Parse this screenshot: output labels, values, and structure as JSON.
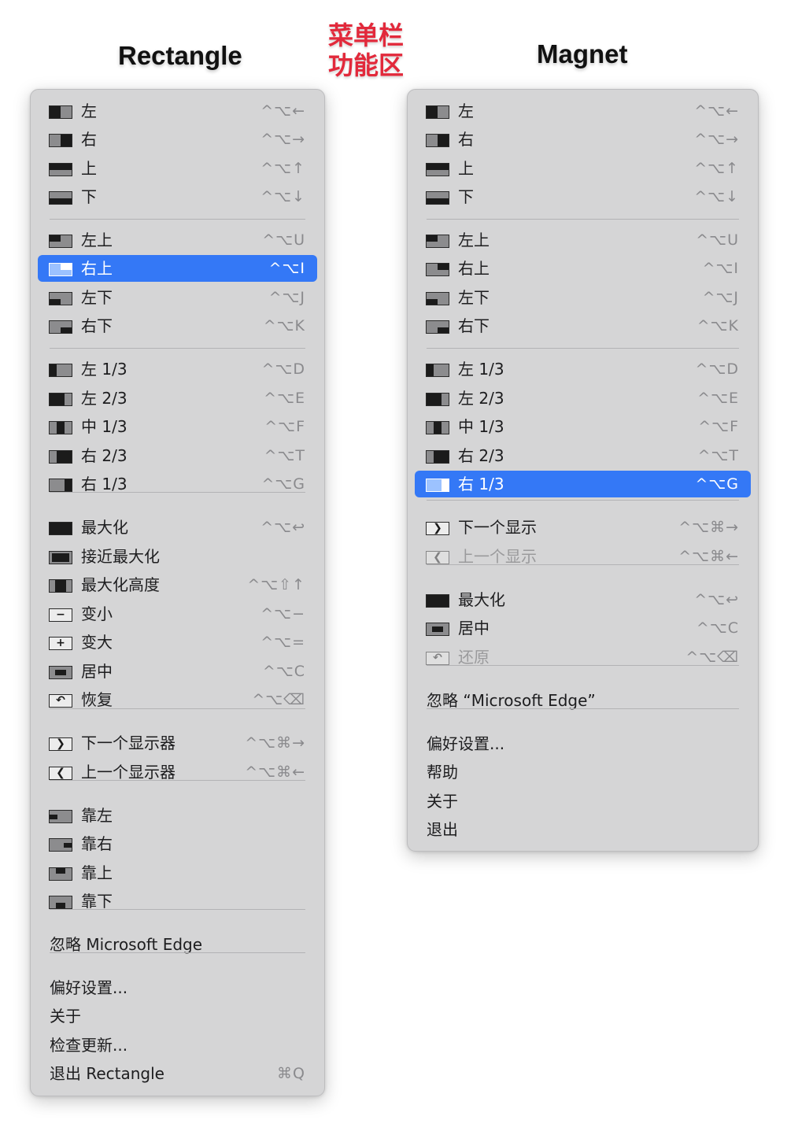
{
  "headings": {
    "rectangle": "Rectangle",
    "magnet": "Magnet",
    "center_label_line1": "菜单栏",
    "center_label_line2": "功能区"
  },
  "colors": {
    "accent_red": "#e2293b",
    "highlight_blue": "#3478f6",
    "menu_bg": "#d5d5d6"
  },
  "rectangle_menu": {
    "items": [
      {
        "label": "左",
        "shortcut": "^⌥←",
        "icon": "left-half-icon"
      },
      {
        "label": "右",
        "shortcut": "^⌥→",
        "icon": "right-half-icon"
      },
      {
        "label": "上",
        "shortcut": "^⌥↑",
        "icon": "top-half-icon"
      },
      {
        "label": "下",
        "shortcut": "^⌥↓",
        "icon": "bottom-half-icon"
      },
      {
        "label": "左上",
        "shortcut": "^⌥U",
        "icon": "top-left-icon"
      },
      {
        "label": "右上",
        "shortcut": "^⌥I",
        "icon": "top-right-icon",
        "selected": true
      },
      {
        "label": "左下",
        "shortcut": "^⌥J",
        "icon": "bottom-left-icon"
      },
      {
        "label": "右下",
        "shortcut": "^⌥K",
        "icon": "bottom-right-icon"
      },
      {
        "label": "左 1/3",
        "shortcut": "^⌥D",
        "icon": "left-third-icon"
      },
      {
        "label": "左 2/3",
        "shortcut": "^⌥E",
        "icon": "left-two-thirds-icon"
      },
      {
        "label": "中 1/3",
        "shortcut": "^⌥F",
        "icon": "center-third-icon"
      },
      {
        "label": "右 2/3",
        "shortcut": "^⌥T",
        "icon": "right-two-thirds-icon"
      },
      {
        "label": "右 1/3",
        "shortcut": "^⌥G",
        "icon": "right-third-icon"
      },
      {
        "label": "最大化",
        "shortcut": "^⌥↩",
        "icon": "maximize-icon"
      },
      {
        "label": "接近最大化",
        "shortcut": "",
        "icon": "almost-maximize-icon"
      },
      {
        "label": "最大化高度",
        "shortcut": "^⌥⇧↑",
        "icon": "maximize-height-icon"
      },
      {
        "label": "变小",
        "shortcut": "^⌥−",
        "icon": "smaller-icon"
      },
      {
        "label": "变大",
        "shortcut": "^⌥=",
        "icon": "larger-icon"
      },
      {
        "label": "居中",
        "shortcut": "^⌥C",
        "icon": "center-icon"
      },
      {
        "label": "恢复",
        "shortcut": "^⌥⌫",
        "icon": "restore-icon"
      },
      {
        "label": "下一个显示器",
        "shortcut": "^⌥⌘→",
        "icon": "next-display-icon"
      },
      {
        "label": "上一个显示器",
        "shortcut": "^⌥⌘←",
        "icon": "previous-display-icon"
      },
      {
        "label": "靠左",
        "shortcut": "",
        "icon": "move-left-icon"
      },
      {
        "label": "靠右",
        "shortcut": "",
        "icon": "move-right-icon"
      },
      {
        "label": "靠上",
        "shortcut": "",
        "icon": "move-up-icon"
      },
      {
        "label": "靠下",
        "shortcut": "",
        "icon": "move-down-icon"
      },
      {
        "label": "忽略 Microsoft Edge",
        "shortcut": ""
      },
      {
        "label": "偏好设置...",
        "shortcut": ""
      },
      {
        "label": "关于",
        "shortcut": ""
      },
      {
        "label": "检查更新...",
        "shortcut": ""
      },
      {
        "label": "退出 Rectangle",
        "shortcut": "⌘Q"
      }
    ]
  },
  "magnet_menu": {
    "items": [
      {
        "label": "左",
        "shortcut": "^⌥←",
        "icon": "left-half-icon"
      },
      {
        "label": "右",
        "shortcut": "^⌥→",
        "icon": "right-half-icon"
      },
      {
        "label": "上",
        "shortcut": "^⌥↑",
        "icon": "top-half-icon"
      },
      {
        "label": "下",
        "shortcut": "^⌥↓",
        "icon": "bottom-half-icon"
      },
      {
        "label": "左上",
        "shortcut": "^⌥U",
        "icon": "top-left-icon"
      },
      {
        "label": "右上",
        "shortcut": "^⌥I",
        "icon": "top-right-icon"
      },
      {
        "label": "左下",
        "shortcut": "^⌥J",
        "icon": "bottom-left-icon"
      },
      {
        "label": "右下",
        "shortcut": "^⌥K",
        "icon": "bottom-right-icon"
      },
      {
        "label": "左 1/3",
        "shortcut": "^⌥D",
        "icon": "left-third-icon"
      },
      {
        "label": "左 2/3",
        "shortcut": "^⌥E",
        "icon": "left-two-thirds-icon"
      },
      {
        "label": "中 1/3",
        "shortcut": "^⌥F",
        "icon": "center-third-icon"
      },
      {
        "label": "右 2/3",
        "shortcut": "^⌥T",
        "icon": "right-two-thirds-icon"
      },
      {
        "label": "右 1/3",
        "shortcut": "^⌥G",
        "icon": "right-third-icon",
        "selected": true
      },
      {
        "label": "下一个显示",
        "shortcut": "^⌥⌘→",
        "icon": "next-display-icon"
      },
      {
        "label": "上一个显示",
        "shortcut": "^⌥⌘←",
        "icon": "previous-display-icon",
        "disabled": true
      },
      {
        "label": "最大化",
        "shortcut": "^⌥↩",
        "icon": "maximize-icon"
      },
      {
        "label": "居中",
        "shortcut": "^⌥C",
        "icon": "center-icon"
      },
      {
        "label": "还原",
        "shortcut": "^⌥⌫",
        "icon": "restore-icon",
        "disabled": true
      },
      {
        "label": "忽略 “Microsoft Edge”",
        "shortcut": ""
      },
      {
        "label": "偏好设置...",
        "shortcut": ""
      },
      {
        "label": "帮助",
        "shortcut": ""
      },
      {
        "label": "关于",
        "shortcut": ""
      },
      {
        "label": "退出",
        "shortcut": ""
      }
    ]
  }
}
